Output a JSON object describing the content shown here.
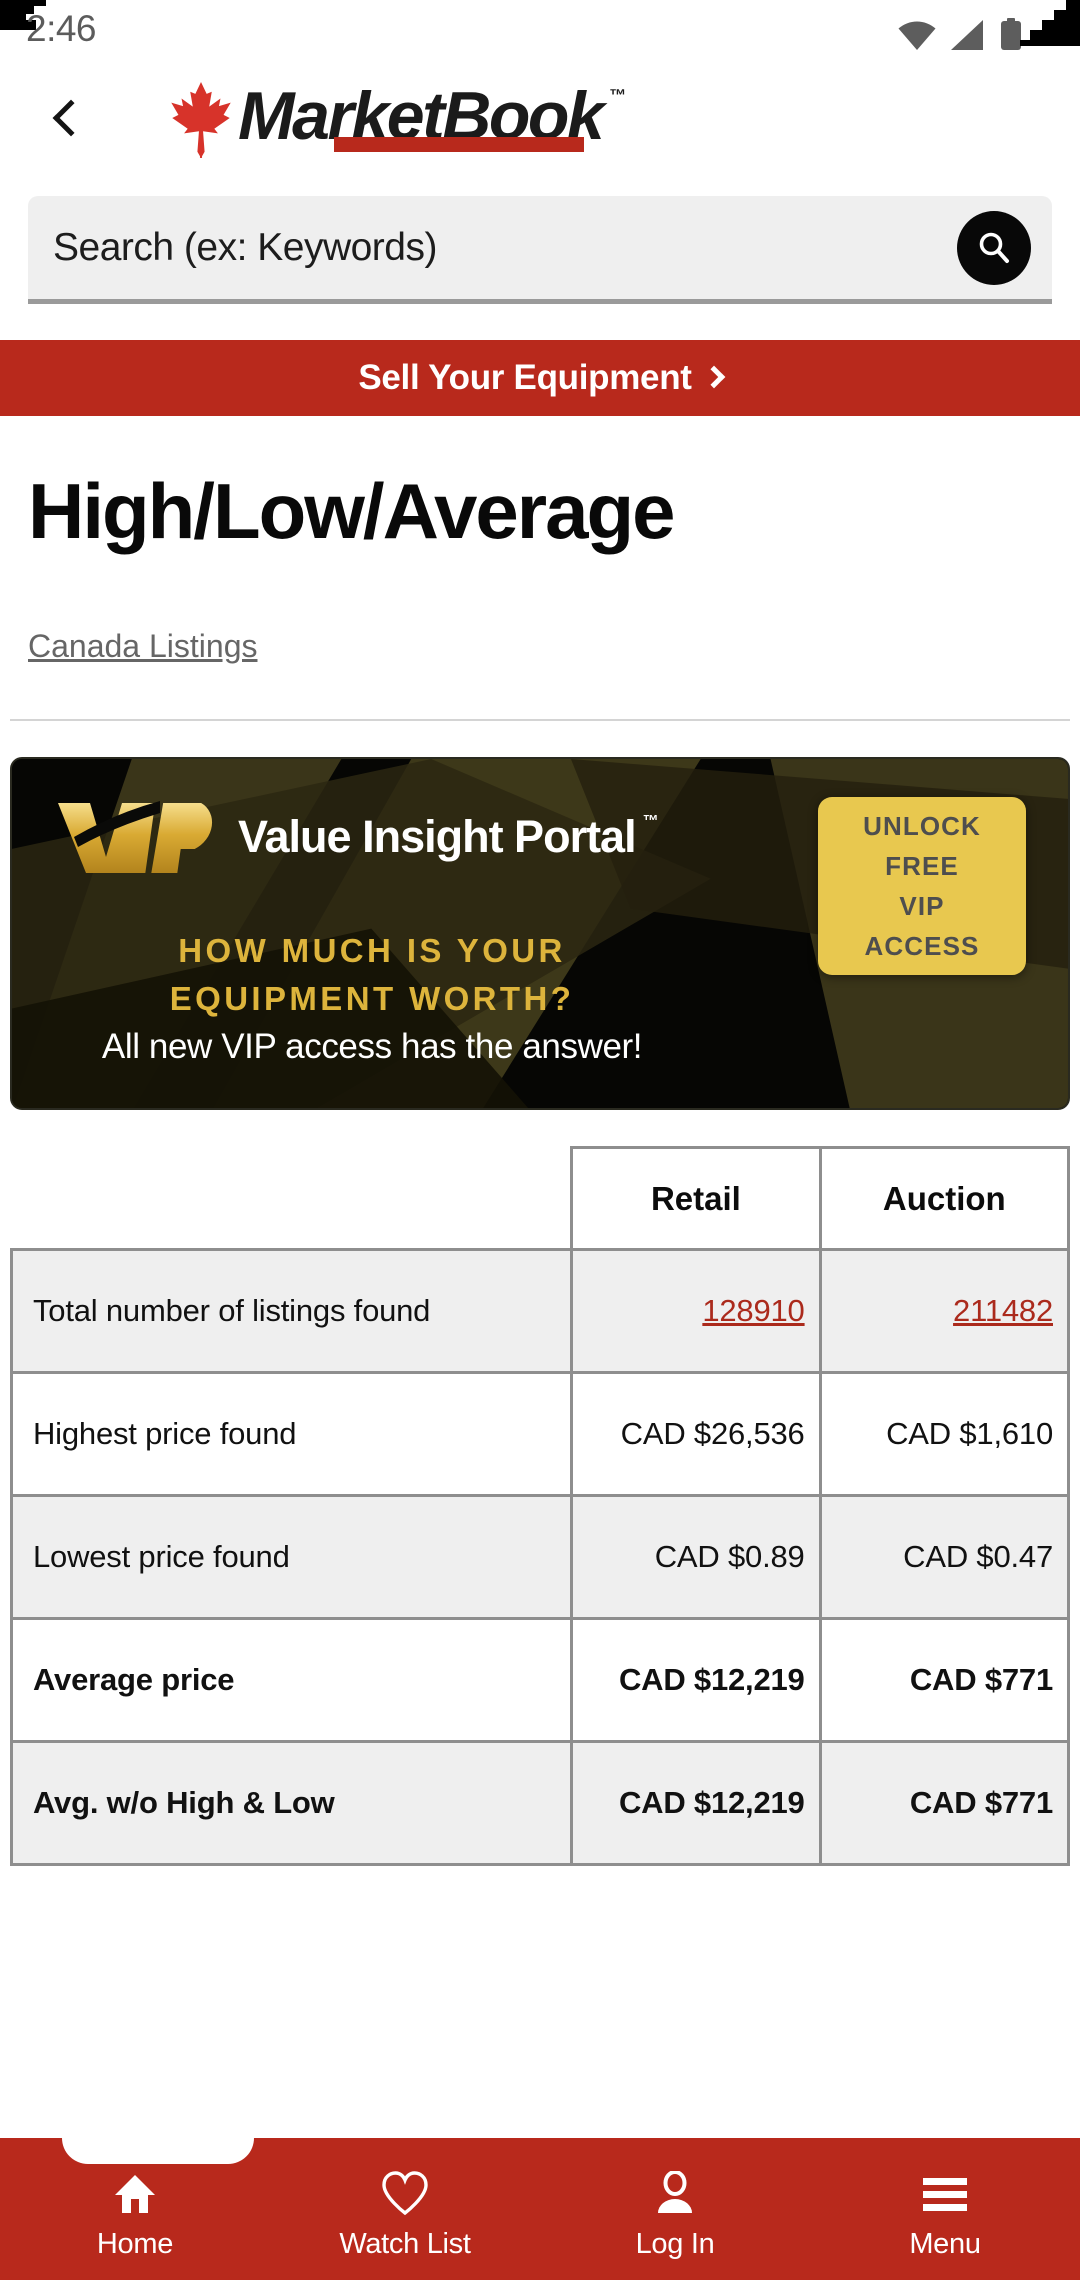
{
  "status_bar": {
    "time": "2:46",
    "icons": [
      "wifi-icon",
      "cell-signal-icon",
      "battery-icon"
    ]
  },
  "header": {
    "back_icon": "chevron-left-icon",
    "logo_text": "MarketBook",
    "logo_tm": "™",
    "leaf_icon": "maple-leaf-icon",
    "leaf_color": "#d7332a"
  },
  "search": {
    "placeholder": "Search (ex: Keywords)",
    "value": "",
    "button_icon": "search-icon"
  },
  "sell_banner": {
    "label": "Sell Your Equipment",
    "chevron_icon": "chevron-right-icon",
    "background": "#b8291c"
  },
  "page": {
    "title": "High/Low/Average",
    "breadcrumb": "Canada Listings"
  },
  "vip_banner": {
    "logo_mark": "VIP",
    "logo_title": "Value Insight Portal",
    "logo_tm": "™",
    "headline_line1": "HOW MUCH IS YOUR",
    "headline_line2": "EQUIPMENT WORTH?",
    "subhead": "All new VIP access has the answer!",
    "cta_lines": [
      "UNLOCK",
      "FREE",
      "VIP",
      "ACCESS"
    ],
    "cta_color": "#e8c84f",
    "gold_color": "#ddb43c"
  },
  "chart_data": {
    "type": "table",
    "title": "High/Low/Average",
    "columns": [
      "",
      "Retail",
      "Auction"
    ],
    "currency": "CAD",
    "rows": [
      {
        "label": "Total number of listings found",
        "retail": "128910",
        "auction": "211482",
        "bold": false,
        "link": true
      },
      {
        "label": "Highest price found",
        "retail": "CAD $26,536",
        "auction": "CAD $1,610",
        "bold": false,
        "link": false
      },
      {
        "label": "Lowest price found",
        "retail": "CAD $0.89",
        "auction": "CAD $0.47",
        "bold": false,
        "link": false
      },
      {
        "label": "Average price",
        "retail": "CAD $12,219",
        "auction": "CAD $771",
        "bold": true,
        "link": false
      },
      {
        "label": "Avg. w/o High & Low",
        "retail": "CAD $12,219",
        "auction": "CAD $771",
        "bold": true,
        "link": false
      }
    ]
  },
  "table": {
    "col_label": "",
    "col_retail": "Retail",
    "col_auction": "Auction",
    "rows": [
      {
        "label": "Total number of listings found",
        "retail": "128910",
        "auction": "211482"
      },
      {
        "label": "Highest price found",
        "retail": "CAD $26,536",
        "auction": "CAD $1,610"
      },
      {
        "label": "Lowest price found",
        "retail": "CAD $0.89",
        "auction": "CAD $0.47"
      },
      {
        "label": "Average price",
        "retail": "CAD $12,219",
        "auction": "CAD $771"
      },
      {
        "label": "Avg. w/o High & Low",
        "retail": "CAD $12,219",
        "auction": "CAD $771"
      }
    ]
  },
  "bottom_nav": {
    "background": "#b8291c",
    "items": [
      {
        "label": "Home",
        "icon": "home-icon"
      },
      {
        "label": "Watch List",
        "icon": "heart-icon"
      },
      {
        "label": "Log In",
        "icon": "person-icon"
      },
      {
        "label": "Menu",
        "icon": "hamburger-menu-icon"
      }
    ]
  }
}
